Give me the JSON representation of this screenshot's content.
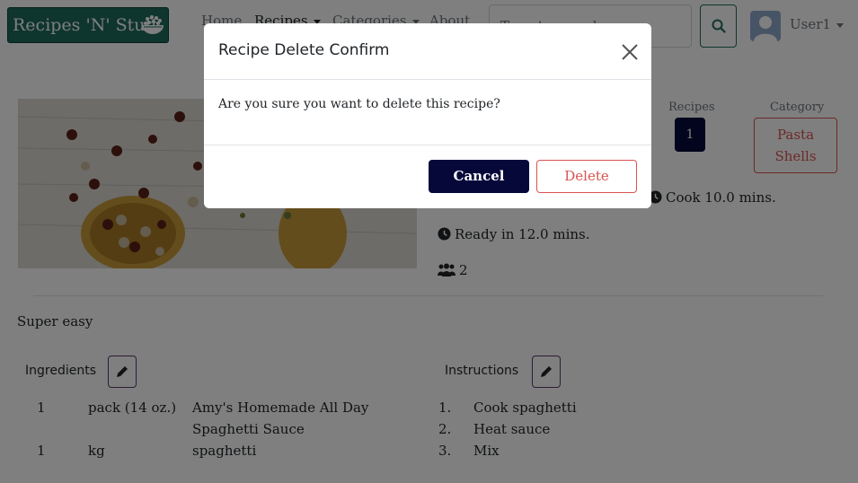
{
  "nav": {
    "brand": "Recipes 'N' Stuff",
    "links": [
      "Home",
      "Recipes",
      "Categories",
      "About"
    ],
    "search_placeholder": "Type to search",
    "user": "User1"
  },
  "recipe": {
    "recipes_label": "Recipes",
    "recipes_count": "1",
    "category_label": "Category",
    "category_value_line1": "Pasta",
    "category_value_line2": "Shells",
    "cook": "Cook 10.0 mins.",
    "ready": "Ready in 12.0 mins.",
    "servings": "2",
    "description": "Super easy"
  },
  "ingredients": {
    "heading": "Ingredients",
    "rows": [
      {
        "qty": "1",
        "unit": "pack (14 oz.)",
        "name_line1": "Amy's Homemade All Day",
        "name_line2": "Spaghetti Sauce"
      },
      {
        "qty": "1",
        "unit": "kg",
        "name_line1": "spaghetti",
        "name_line2": ""
      }
    ]
  },
  "instructions": {
    "heading": "Instructions",
    "steps": [
      {
        "num": "1.",
        "text": "Cook spaghetti"
      },
      {
        "num": "2.",
        "text": "Heat sauce"
      },
      {
        "num": "3.",
        "text": "Mix"
      }
    ]
  },
  "modal": {
    "title": "Recipe Delete Confirm",
    "body": "Are you sure you want to delete this recipe?",
    "cancel": "Cancel",
    "delete": "Delete"
  },
  "colors": {
    "brand": "#1c6b5c",
    "dark_navy": "#06083a",
    "danger": "#d9534f"
  }
}
